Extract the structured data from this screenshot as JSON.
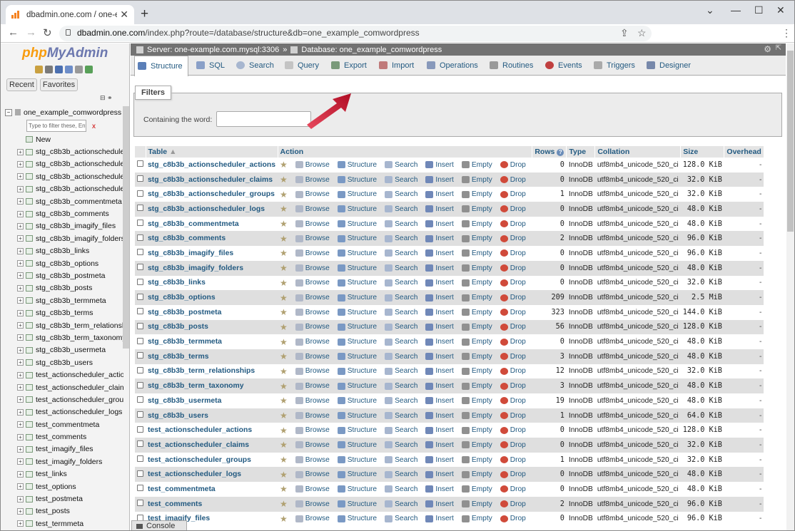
{
  "browser": {
    "tab_title": "dbadmin.one.com / one-example",
    "url_domain": "dbadmin.one.com",
    "url_path": "/index.php?route=/database/structure&db=one_example_comwordpress"
  },
  "nav": {
    "logo_php": "php",
    "logo_myadmin": "MyAdmin",
    "tabs": [
      "Recent",
      "Favorites"
    ],
    "database": "one_example_comwordpress",
    "filter_placeholder": "Type to filter these, Enter",
    "filter_clear": "x",
    "new_label": "New",
    "tables": [
      "stg_c8b3b_actionschedule",
      "stg_c8b3b_actionschedule",
      "stg_c8b3b_actionschedule",
      "stg_c8b3b_actionschedule",
      "stg_c8b3b_commentmeta",
      "stg_c8b3b_comments",
      "stg_c8b3b_imagify_files",
      "stg_c8b3b_imagify_folders",
      "stg_c8b3b_links",
      "stg_c8b3b_options",
      "stg_c8b3b_postmeta",
      "stg_c8b3b_posts",
      "stg_c8b3b_termmeta",
      "stg_c8b3b_terms",
      "stg_c8b3b_term_relationsh",
      "stg_c8b3b_term_taxonomy",
      "stg_c8b3b_usermeta",
      "stg_c8b3b_users",
      "test_actionscheduler_actio",
      "test_actionscheduler_clain",
      "test_actionscheduler_grou",
      "test_actionscheduler_logs",
      "test_commentmeta",
      "test_comments",
      "test_imagify_files",
      "test_imagify_folders",
      "test_links",
      "test_options",
      "test_postmeta",
      "test_posts",
      "test_termmeta"
    ]
  },
  "breadcrumb": {
    "server": "Server: one-example.com.mysql:3306",
    "sep": "»",
    "database": "Database: one_example_comwordpress"
  },
  "menu": [
    "Structure",
    "SQL",
    "Search",
    "Query",
    "Export",
    "Import",
    "Operations",
    "Routines",
    "Events",
    "Triggers",
    "Designer"
  ],
  "filters": {
    "legend": "Filters",
    "label": "Containing the word:",
    "value": ""
  },
  "table_headers": {
    "table": "Table",
    "action": "Action",
    "rows": "Rows",
    "type": "Type",
    "collation": "Collation",
    "size": "Size",
    "overhead": "Overhead"
  },
  "actions": {
    "browse": "Browse",
    "structure": "Structure",
    "search": "Search",
    "insert": "Insert",
    "empty": "Empty",
    "drop": "Drop"
  },
  "rows": [
    {
      "name": "stg_c8b3b_actionscheduler_actions",
      "rows": "0",
      "type": "InnoDB",
      "collation": "utf8mb4_unicode_520_ci",
      "size": "128.0 KiB",
      "overhead": "-"
    },
    {
      "name": "stg_c8b3b_actionscheduler_claims",
      "rows": "0",
      "type": "InnoDB",
      "collation": "utf8mb4_unicode_520_ci",
      "size": "32.0 KiB",
      "overhead": "-"
    },
    {
      "name": "stg_c8b3b_actionscheduler_groups",
      "rows": "1",
      "type": "InnoDB",
      "collation": "utf8mb4_unicode_520_ci",
      "size": "32.0 KiB",
      "overhead": "-"
    },
    {
      "name": "stg_c8b3b_actionscheduler_logs",
      "rows": "0",
      "type": "InnoDB",
      "collation": "utf8mb4_unicode_520_ci",
      "size": "48.0 KiB",
      "overhead": "-"
    },
    {
      "name": "stg_c8b3b_commentmeta",
      "rows": "0",
      "type": "InnoDB",
      "collation": "utf8mb4_unicode_520_ci",
      "size": "48.0 KiB",
      "overhead": "-"
    },
    {
      "name": "stg_c8b3b_comments",
      "rows": "2",
      "type": "InnoDB",
      "collation": "utf8mb4_unicode_520_ci",
      "size": "96.0 KiB",
      "overhead": "-"
    },
    {
      "name": "stg_c8b3b_imagify_files",
      "rows": "0",
      "type": "InnoDB",
      "collation": "utf8mb4_unicode_520_ci",
      "size": "96.0 KiB",
      "overhead": "-"
    },
    {
      "name": "stg_c8b3b_imagify_folders",
      "rows": "0",
      "type": "InnoDB",
      "collation": "utf8mb4_unicode_520_ci",
      "size": "48.0 KiB",
      "overhead": "-"
    },
    {
      "name": "stg_c8b3b_links",
      "rows": "0",
      "type": "InnoDB",
      "collation": "utf8mb4_unicode_520_ci",
      "size": "32.0 KiB",
      "overhead": "-"
    },
    {
      "name": "stg_c8b3b_options",
      "rows": "209",
      "type": "InnoDB",
      "collation": "utf8mb4_unicode_520_ci",
      "size": "2.5 MiB",
      "overhead": "-"
    },
    {
      "name": "stg_c8b3b_postmeta",
      "rows": "323",
      "type": "InnoDB",
      "collation": "utf8mb4_unicode_520_ci",
      "size": "144.0 KiB",
      "overhead": "-"
    },
    {
      "name": "stg_c8b3b_posts",
      "rows": "56",
      "type": "InnoDB",
      "collation": "utf8mb4_unicode_520_ci",
      "size": "128.0 KiB",
      "overhead": "-"
    },
    {
      "name": "stg_c8b3b_termmeta",
      "rows": "0",
      "type": "InnoDB",
      "collation": "utf8mb4_unicode_520_ci",
      "size": "48.0 KiB",
      "overhead": "-"
    },
    {
      "name": "stg_c8b3b_terms",
      "rows": "3",
      "type": "InnoDB",
      "collation": "utf8mb4_unicode_520_ci",
      "size": "48.0 KiB",
      "overhead": "-"
    },
    {
      "name": "stg_c8b3b_term_relationships",
      "rows": "12",
      "type": "InnoDB",
      "collation": "utf8mb4_unicode_520_ci",
      "size": "32.0 KiB",
      "overhead": "-"
    },
    {
      "name": "stg_c8b3b_term_taxonomy",
      "rows": "3",
      "type": "InnoDB",
      "collation": "utf8mb4_unicode_520_ci",
      "size": "48.0 KiB",
      "overhead": "-"
    },
    {
      "name": "stg_c8b3b_usermeta",
      "rows": "19",
      "type": "InnoDB",
      "collation": "utf8mb4_unicode_520_ci",
      "size": "48.0 KiB",
      "overhead": "-"
    },
    {
      "name": "stg_c8b3b_users",
      "rows": "1",
      "type": "InnoDB",
      "collation": "utf8mb4_unicode_520_ci",
      "size": "64.0 KiB",
      "overhead": "-"
    },
    {
      "name": "test_actionscheduler_actions",
      "rows": "0",
      "type": "InnoDB",
      "collation": "utf8mb4_unicode_520_ci",
      "size": "128.0 KiB",
      "overhead": "-"
    },
    {
      "name": "test_actionscheduler_claims",
      "rows": "0",
      "type": "InnoDB",
      "collation": "utf8mb4_unicode_520_ci",
      "size": "32.0 KiB",
      "overhead": "-"
    },
    {
      "name": "test_actionscheduler_groups",
      "rows": "1",
      "type": "InnoDB",
      "collation": "utf8mb4_unicode_520_ci",
      "size": "32.0 KiB",
      "overhead": "-"
    },
    {
      "name": "test_actionscheduler_logs",
      "rows": "0",
      "type": "InnoDB",
      "collation": "utf8mb4_unicode_520_ci",
      "size": "48.0 KiB",
      "overhead": "-"
    },
    {
      "name": "test_commentmeta",
      "rows": "0",
      "type": "InnoDB",
      "collation": "utf8mb4_unicode_520_ci",
      "size": "48.0 KiB",
      "overhead": "-"
    },
    {
      "name": "test_comments",
      "rows": "2",
      "type": "InnoDB",
      "collation": "utf8mb4_unicode_520_ci",
      "size": "96.0 KiB",
      "overhead": "-"
    },
    {
      "name": "test_imagify_files",
      "rows": "0",
      "type": "InnoDB",
      "collation": "utf8mb4_unicode_520_ci",
      "size": "96.0 KiB",
      "overhead": "-"
    }
  ],
  "console_label": "Console",
  "colors": {
    "link": "#235a81",
    "highlight_arrow": "#c8102e",
    "server_bar": "#727272"
  }
}
